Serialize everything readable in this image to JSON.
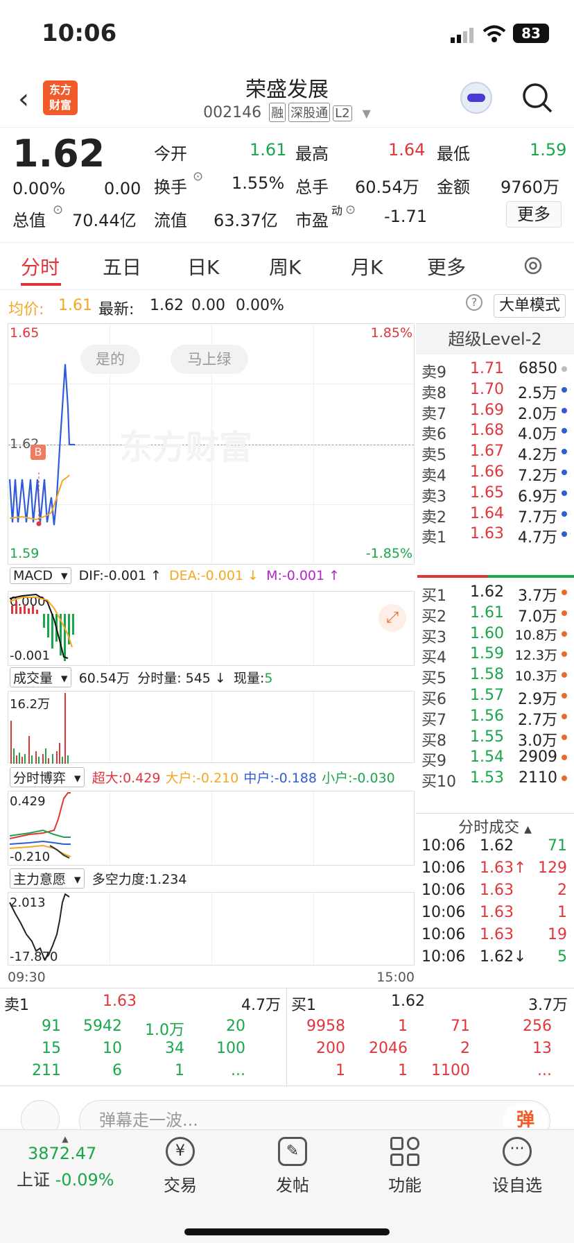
{
  "status": {
    "time": "10:06",
    "battery": "83"
  },
  "header": {
    "title": "荣盛发展",
    "code": "002146",
    "tags": [
      "融",
      "深股通",
      "L2"
    ],
    "logo": [
      "东方",
      "财富"
    ]
  },
  "quote": {
    "price": "1.62",
    "change_pct": "0.00%",
    "change": "0.00",
    "fields": [
      {
        "label": "今开",
        "value": "1.61",
        "color": "green"
      },
      {
        "label": "最高",
        "value": "1.64",
        "color": "red"
      },
      {
        "label": "最低",
        "value": "1.59",
        "color": "green"
      },
      {
        "label": "换手",
        "value": "1.55%",
        "color": "black"
      },
      {
        "label": "总手",
        "value": "60.54万",
        "color": "black"
      },
      {
        "label": "金额",
        "value": "9760万",
        "color": "black"
      },
      {
        "label": "总值",
        "value": "70.44亿",
        "color": "black"
      },
      {
        "label": "流值",
        "value": "63.37亿",
        "color": "black"
      },
      {
        "label": "市盈",
        "value": "-1.71",
        "color": "black"
      }
    ],
    "pe_sup": "动",
    "more": "更多"
  },
  "tabs": [
    "分时",
    "五日",
    "日K",
    "周K",
    "月K",
    "更多"
  ],
  "infobar": {
    "avg_label": "均价:",
    "avg": "1.61",
    "latest_label": "最新:",
    "latest": "1.62",
    "chg": "0.00",
    "pct": "0.00%",
    "mode": "大单模式"
  },
  "chart": {
    "price_high": "1.65",
    "price_low": "1.59",
    "pct_high": "1.85%",
    "pct_low": "-1.85%",
    "mid": "1.62",
    "buttons": [
      "是的",
      "马上绿"
    ],
    "watermark": "东方财富",
    "marker": "B",
    "time_start": "09:30",
    "time_end": "15:00"
  },
  "macd": {
    "name": "MACD",
    "dif": "DIF:-0.001 ↑",
    "dea": "DEA:-0.001 ↓",
    "m": "M:-0.001 ↑",
    "top": "0.000",
    "bottom": "-0.001"
  },
  "volume": {
    "name": "成交量",
    "total": "60.54万",
    "minute": "分时量: 545 ↓",
    "now_label": "现量:",
    "now": "5",
    "top": "16.2万"
  },
  "game": {
    "name": "分时博弈",
    "super": "超大:0.429",
    "big": "大户:-0.210",
    "mid": "中户:-0.188",
    "small": "小户:-0.030",
    "top": "0.429",
    "bottom": "-0.210"
  },
  "intent": {
    "name": "主力意愿",
    "force": "多空力度:1.234",
    "top": "2.013",
    "bottom": "-17.870"
  },
  "orderbook": {
    "title": "超级Level-2",
    "sells": [
      {
        "label": "卖9",
        "price": "1.71",
        "vol": "6850",
        "dot": "#bbb"
      },
      {
        "label": "卖8",
        "price": "1.70",
        "vol": "2.5万",
        "dot": "#2e5bd8"
      },
      {
        "label": "卖7",
        "price": "1.69",
        "vol": "2.0万",
        "dot": "#2e5bd8"
      },
      {
        "label": "卖6",
        "price": "1.68",
        "vol": "4.0万",
        "dot": "#2e5bd8"
      },
      {
        "label": "卖5",
        "price": "1.67",
        "vol": "4.2万",
        "dot": "#2e5bd8"
      },
      {
        "label": "卖4",
        "price": "1.66",
        "vol": "7.2万",
        "dot": "#2e5bd8"
      },
      {
        "label": "卖3",
        "price": "1.65",
        "vol": "6.9万",
        "dot": "#2e5bd8"
      },
      {
        "label": "卖2",
        "price": "1.64",
        "vol": "7.7万",
        "dot": "#2e5bd8"
      },
      {
        "label": "卖1",
        "price": "1.63",
        "vol": "4.7万",
        "dot": "#2e5bd8"
      }
    ],
    "buys": [
      {
        "label": "买1",
        "price": "1.62",
        "vol": "3.7万",
        "dot": "#e86a2e"
      },
      {
        "label": "买2",
        "price": "1.61",
        "vol": "7.0万",
        "dot": "#e86a2e"
      },
      {
        "label": "买3",
        "price": "1.60",
        "vol": "10.8万",
        "dot": "#e86a2e"
      },
      {
        "label": "买4",
        "price": "1.59",
        "vol": "12.3万",
        "dot": "#e86a2e"
      },
      {
        "label": "买5",
        "price": "1.58",
        "vol": "10.3万",
        "dot": "#e86a2e"
      },
      {
        "label": "买6",
        "price": "1.57",
        "vol": "2.9万",
        "dot": "#e86a2e"
      },
      {
        "label": "买7",
        "price": "1.56",
        "vol": "2.7万",
        "dot": "#e86a2e"
      },
      {
        "label": "买8",
        "price": "1.55",
        "vol": "3.0万",
        "dot": "#e86a2e"
      },
      {
        "label": "买9",
        "price": "1.54",
        "vol": "2909",
        "dot": "#e86a2e"
      },
      {
        "label": "买10",
        "price": "1.53",
        "vol": "2110",
        "dot": "#e86a2e"
      }
    ],
    "trades_title": "分时成交",
    "trades": [
      {
        "t": "10:06",
        "p": "1.62",
        "v": "71",
        "pc": "#222",
        "vc": "green"
      },
      {
        "t": "10:06",
        "p": "1.63↑",
        "v": "129",
        "pc": "red",
        "vc": "red"
      },
      {
        "t": "10:06",
        "p": "1.63",
        "v": "2",
        "pc": "red",
        "vc": "red"
      },
      {
        "t": "10:06",
        "p": "1.63",
        "v": "1",
        "pc": "red",
        "vc": "red"
      },
      {
        "t": "10:06",
        "p": "1.63",
        "v": "19",
        "pc": "red",
        "vc": "red"
      },
      {
        "t": "10:06",
        "p": "1.62↓",
        "v": "5",
        "pc": "#222",
        "vc": "green"
      }
    ]
  },
  "queue": {
    "sell_label": "卖1",
    "sell_price": "1.63",
    "sell_vol": "4.7万",
    "buy_label": "买1",
    "buy_price": "1.62",
    "buy_vol": "3.7万",
    "sell_rows": [
      [
        "91",
        "5942",
        "1.0万",
        "20"
      ],
      [
        "15",
        "10",
        "34",
        "100"
      ],
      [
        "211",
        "6",
        "1",
        "..."
      ]
    ],
    "buy_rows": [
      [
        "9958",
        "1",
        "71",
        "256"
      ],
      [
        "200",
        "2046",
        "2",
        "13"
      ],
      [
        "1",
        "1",
        "1100",
        "..."
      ]
    ]
  },
  "comment": {
    "placeholder": "弹幕走一波..."
  },
  "bottomnav": {
    "index_value": "3872.47",
    "index_name": "上证",
    "index_change": "-0.09%",
    "items": [
      "交易",
      "发帖",
      "功能",
      "设自选"
    ]
  }
}
